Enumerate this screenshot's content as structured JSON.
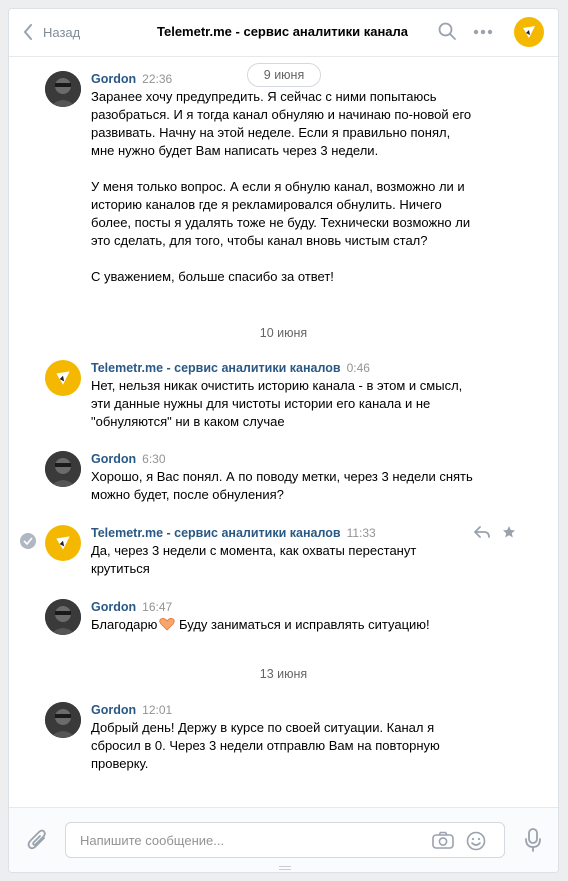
{
  "header": {
    "back_label": "Назад",
    "title": "Telemetr.me - сервис аналитики канала",
    "avatar_icon": "telemetr-logo-icon",
    "accent": "#f5b800"
  },
  "dates": {
    "d1": "9 июня",
    "d2": "10 июня",
    "d3": "13 июня"
  },
  "messages": [
    {
      "author": "Gordon",
      "time": "22:36",
      "text": "Заранее хочу предупредить. Я сейчас с ними попытаюсь\nразобраться. И я тогда канал обнуляю и начинаю по-новой его\nразвивать. Начну на этой неделе. Если я правильно понял,\nмне нужно будет Вам написать через 3 недели.\n\nУ меня только вопрос. А если я обнулю канал, возможно ли и\nисторию каналов где я рекламировался обнулить. Ничего\nболее, посты я удалять тоже не буду. Технически возможно ли\nэто сделать, для того, чтобы канал вновь чистым стал?\n\nС уважением, больше спасибо за ответ!"
    },
    {
      "author": "Telemetr.me - сервис аналитики каналов",
      "time": "0:46",
      "text": "Нет, нельзя никак очистить историю канала - в этом и смысл,\nэти данные нужны для чистоты истории его канала и не\n\"обнуляются\" ни в каком случае"
    },
    {
      "author": "Gordon",
      "time": "6:30",
      "text": "Хорошо, я Вас понял. А по поводу метки, через 3 недели снять\nможно будет, после обнуления?"
    },
    {
      "author": "Telemetr.me - сервис аналитики каналов",
      "time": "11:33",
      "text": "Да, через 3 недели с момента, как охваты перестанут\nкрутиться"
    },
    {
      "author": "Gordon",
      "time": "16:47",
      "text_before": "Благодарю",
      "text_after": " Буду заниматься и исправлять ситуацию!",
      "emoji_icon": "heart-hands-emoji-icon"
    },
    {
      "author": "Gordon",
      "time": "12:01",
      "text": "Добрый день! Держу в курсе по своей ситуации. Канал я\nсбросил в 0. Через 3 недели отправлю Вам на повторную\nпроверку."
    }
  ],
  "composer": {
    "placeholder": "Напишите сообщение..."
  }
}
